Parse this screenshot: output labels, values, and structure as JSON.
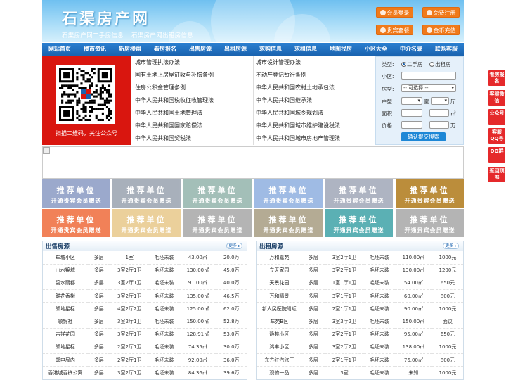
{
  "header": {
    "site_title": "石渠房产网",
    "subtitle_links": [
      "石渠房产网二手房信息",
      "石渠房产网出租房信息"
    ],
    "buttons": [
      "会员登录",
      "免费注册",
      "贵宾套餐",
      "金币充值"
    ]
  },
  "nav": [
    "网站首页",
    "楼市资讯",
    "新房楼盘",
    "看房报名",
    "出售房源",
    "出租房源",
    "求购信息",
    "求租信息",
    "地图找房",
    "小区大全",
    "中介名录",
    "联系客服"
  ],
  "qr": {
    "caption": "扫描二维码，关注公众号"
  },
  "links": {
    "left": [
      "城市管理执法办法",
      "国有土地上房屋征收与补偿条例",
      "住房公积金管理条例",
      "中华人民共和国税收征收管理法",
      "中华人民共和国土地管理法",
      "中华人民共和国国家赔偿法",
      "中华人民共和国契税法"
    ],
    "right": [
      "城市设计管理办法",
      "不动产登记暂行条例",
      "中华人民共和国农村土地承包法",
      "中华人民共和国继承法",
      "中华人民共和国城乡规划法",
      "中华人民共和国城市维护建设税法",
      "中华人民共和国城市房地产管理法"
    ]
  },
  "search": {
    "type_label": "类型:",
    "type_options": [
      "二手房",
      "出租房"
    ],
    "selected_type": "二手房",
    "community_label": "小区:",
    "housetype_label": "房型:",
    "housetype_value": "-- 可选择 --",
    "layout_label": "户型:",
    "room_unit": "室",
    "hall_unit": "厅",
    "area_label": "面积:",
    "area_unit": "㎡",
    "price_label": "价格:",
    "price_unit": "万",
    "range_sep": "~",
    "submit": "确认提交搜索"
  },
  "tiles": {
    "line1": "推荐单位",
    "line2": "开通贵宾会员赠送",
    "colors": [
      "#8a9bc4",
      "#9aa3b0",
      "#93b5ac",
      "#8fb0e0",
      "#a0a7b8",
      "#b07a1a",
      "#ef6c3c",
      "#e8c88a",
      "#a8a8a8",
      "#a89d82",
      "#3fa3a7",
      "#a8a8a8"
    ]
  },
  "sale": {
    "title": "出售房源",
    "more": "更多",
    "rows": [
      [
        "车城小区",
        "多层",
        "1室",
        "毛坯未装",
        "43.00㎡",
        "20.0万"
      ],
      [
        "山水锦城",
        "多层",
        "3室2厅1卫",
        "毛坯未装",
        "130.00㎡",
        "45.0万"
      ],
      [
        "碧水丽都",
        "多层",
        "3室2厅1卫",
        "毛坯未装",
        "91.00㎡",
        "40.0万"
      ],
      [
        "鲜花香榭",
        "多层",
        "3室2厅1卫",
        "毛坯未装",
        "135.00㎡",
        "46.5万"
      ],
      [
        "领地星标",
        "多层",
        "4室2厅2卫",
        "毛坯未装",
        "125.00㎡",
        "62.0万"
      ],
      [
        "领锦社",
        "多层",
        "3室2厅1卫",
        "毛坯未装",
        "150.00㎡",
        "52.8万"
      ],
      [
        "吉祥花园",
        "多层",
        "3室2厅1卫",
        "毛坯未装",
        "128.91㎡",
        "53.0万"
      ],
      [
        "领地星标",
        "多层",
        "2室2厅1卫",
        "毛坯未装",
        "74.35㎡",
        "30.0万"
      ],
      [
        "邮电局内",
        "多层",
        "2室2厅1卫",
        "毛坯未装",
        "92.00㎡",
        "36.0万"
      ],
      [
        "香港城香槟公寓",
        "多层",
        "3室2厅1卫",
        "毛坯未装",
        "84.36㎡",
        "39.6万"
      ]
    ]
  },
  "rent": {
    "title": "出租房源",
    "more": "更多",
    "rows": [
      [
        "万和嘉苑",
        "多层",
        "3室2厅1卫",
        "毛坯未装",
        "110.00㎡",
        "1000元"
      ],
      [
        "立天家园",
        "多层",
        "3室2厅1卫",
        "毛坯未装",
        "130.00㎡",
        "1200元"
      ],
      [
        "天景花园",
        "多层",
        "1室1厅1卫",
        "毛坯未装",
        "54.00㎡",
        "650元"
      ],
      [
        "万和晴景",
        "多层",
        "3室1厅1卫",
        "毛坯未装",
        "60.00㎡",
        "800元"
      ],
      [
        "新人民医院附近",
        "多层",
        "2室1厅1卫",
        "毛坯未装",
        "90.00㎡",
        "1000元"
      ],
      [
        "车苑B区",
        "多层",
        "3室3厅2卫",
        "毛坯未装",
        "150.00㎡",
        "面议"
      ],
      [
        "静苑小区",
        "多层",
        "2室2厅1卫",
        "毛坯未装",
        "95.00㎡",
        "650元"
      ],
      [
        "鸿丰小区",
        "多层",
        "3室2厅2卫",
        "毛坯未装",
        "138.00㎡",
        "1000元"
      ],
      [
        "东方红汽修厂",
        "多层",
        "2室1厅1卫",
        "毛坯未装",
        "76.00㎡",
        "800元"
      ],
      [
        "观俯一品",
        "多层",
        "3室",
        "毛坯未装",
        "未知",
        "1000元"
      ]
    ]
  },
  "side": [
    "看房报名",
    "客服微信",
    "公众号",
    "客服QQ号",
    "QQ群",
    "返回顶部"
  ]
}
